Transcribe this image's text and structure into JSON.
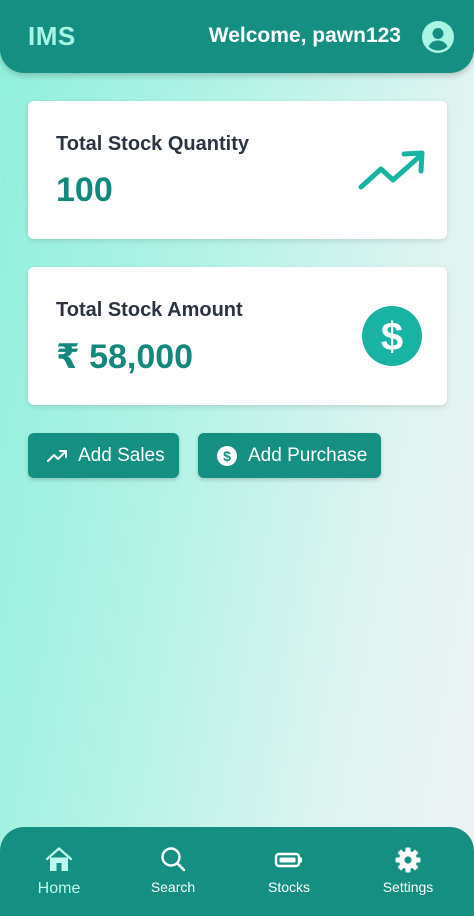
{
  "header": {
    "app_title": "IMS",
    "welcome_text": "Welcome, pawn123",
    "avatar_icon": "account-circle-icon"
  },
  "cards": {
    "quantity": {
      "label": "Total Stock Quantity",
      "value": "100",
      "icon": "trending-up-icon"
    },
    "amount": {
      "label": "Total Stock Amount",
      "value": "₹ 58,000",
      "icon": "dollar-circle-icon"
    }
  },
  "actions": {
    "add_sales": {
      "label": "Add Sales",
      "icon": "trending-up-icon"
    },
    "add_purchase": {
      "label": "Add Purchase",
      "icon": "dollar-circle-icon"
    }
  },
  "nav": {
    "items": [
      {
        "label": "Home",
        "icon": "home-icon",
        "active": true
      },
      {
        "label": "Search",
        "icon": "search-icon",
        "active": false
      },
      {
        "label": "Stocks",
        "icon": "battery-icon",
        "active": false
      },
      {
        "label": "Settings",
        "icon": "gear-icon",
        "active": false
      }
    ]
  },
  "colors": {
    "primary": "#148f82",
    "accent_light": "#a8f5e4",
    "value_text": "#13887c",
    "icon_circle": "#19b3a3"
  }
}
